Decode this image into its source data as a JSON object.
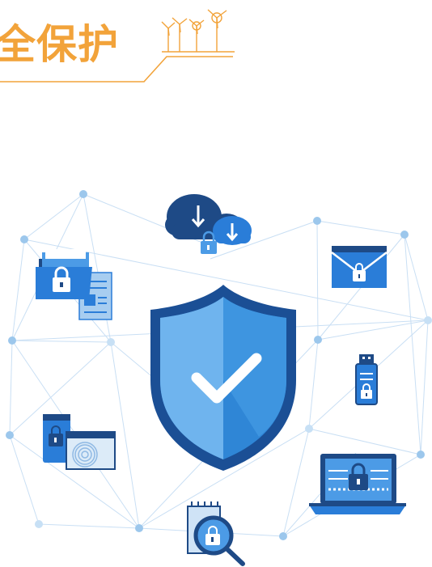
{
  "header": {
    "title": "全保护"
  },
  "colors": {
    "accent_orange": "#F2A33A",
    "shield_dark": "#1B4F95",
    "shield_mid": "#2F86D6",
    "shield_light": "#6FB4EE",
    "node_blue": "#9CC7EC",
    "line_blue": "#C9DFF4",
    "navy": "#1E4A86",
    "blue": "#2A7DD8"
  },
  "icons": [
    "cloud-download-lock-icon",
    "folder-lock-icon",
    "document-icon",
    "envelope-lock-icon",
    "usb-lock-icon",
    "phone-fingerprint-icon",
    "laptop-lock-icon",
    "search-lock-icon",
    "shield-check-icon",
    "wind-turbine-icon"
  ]
}
